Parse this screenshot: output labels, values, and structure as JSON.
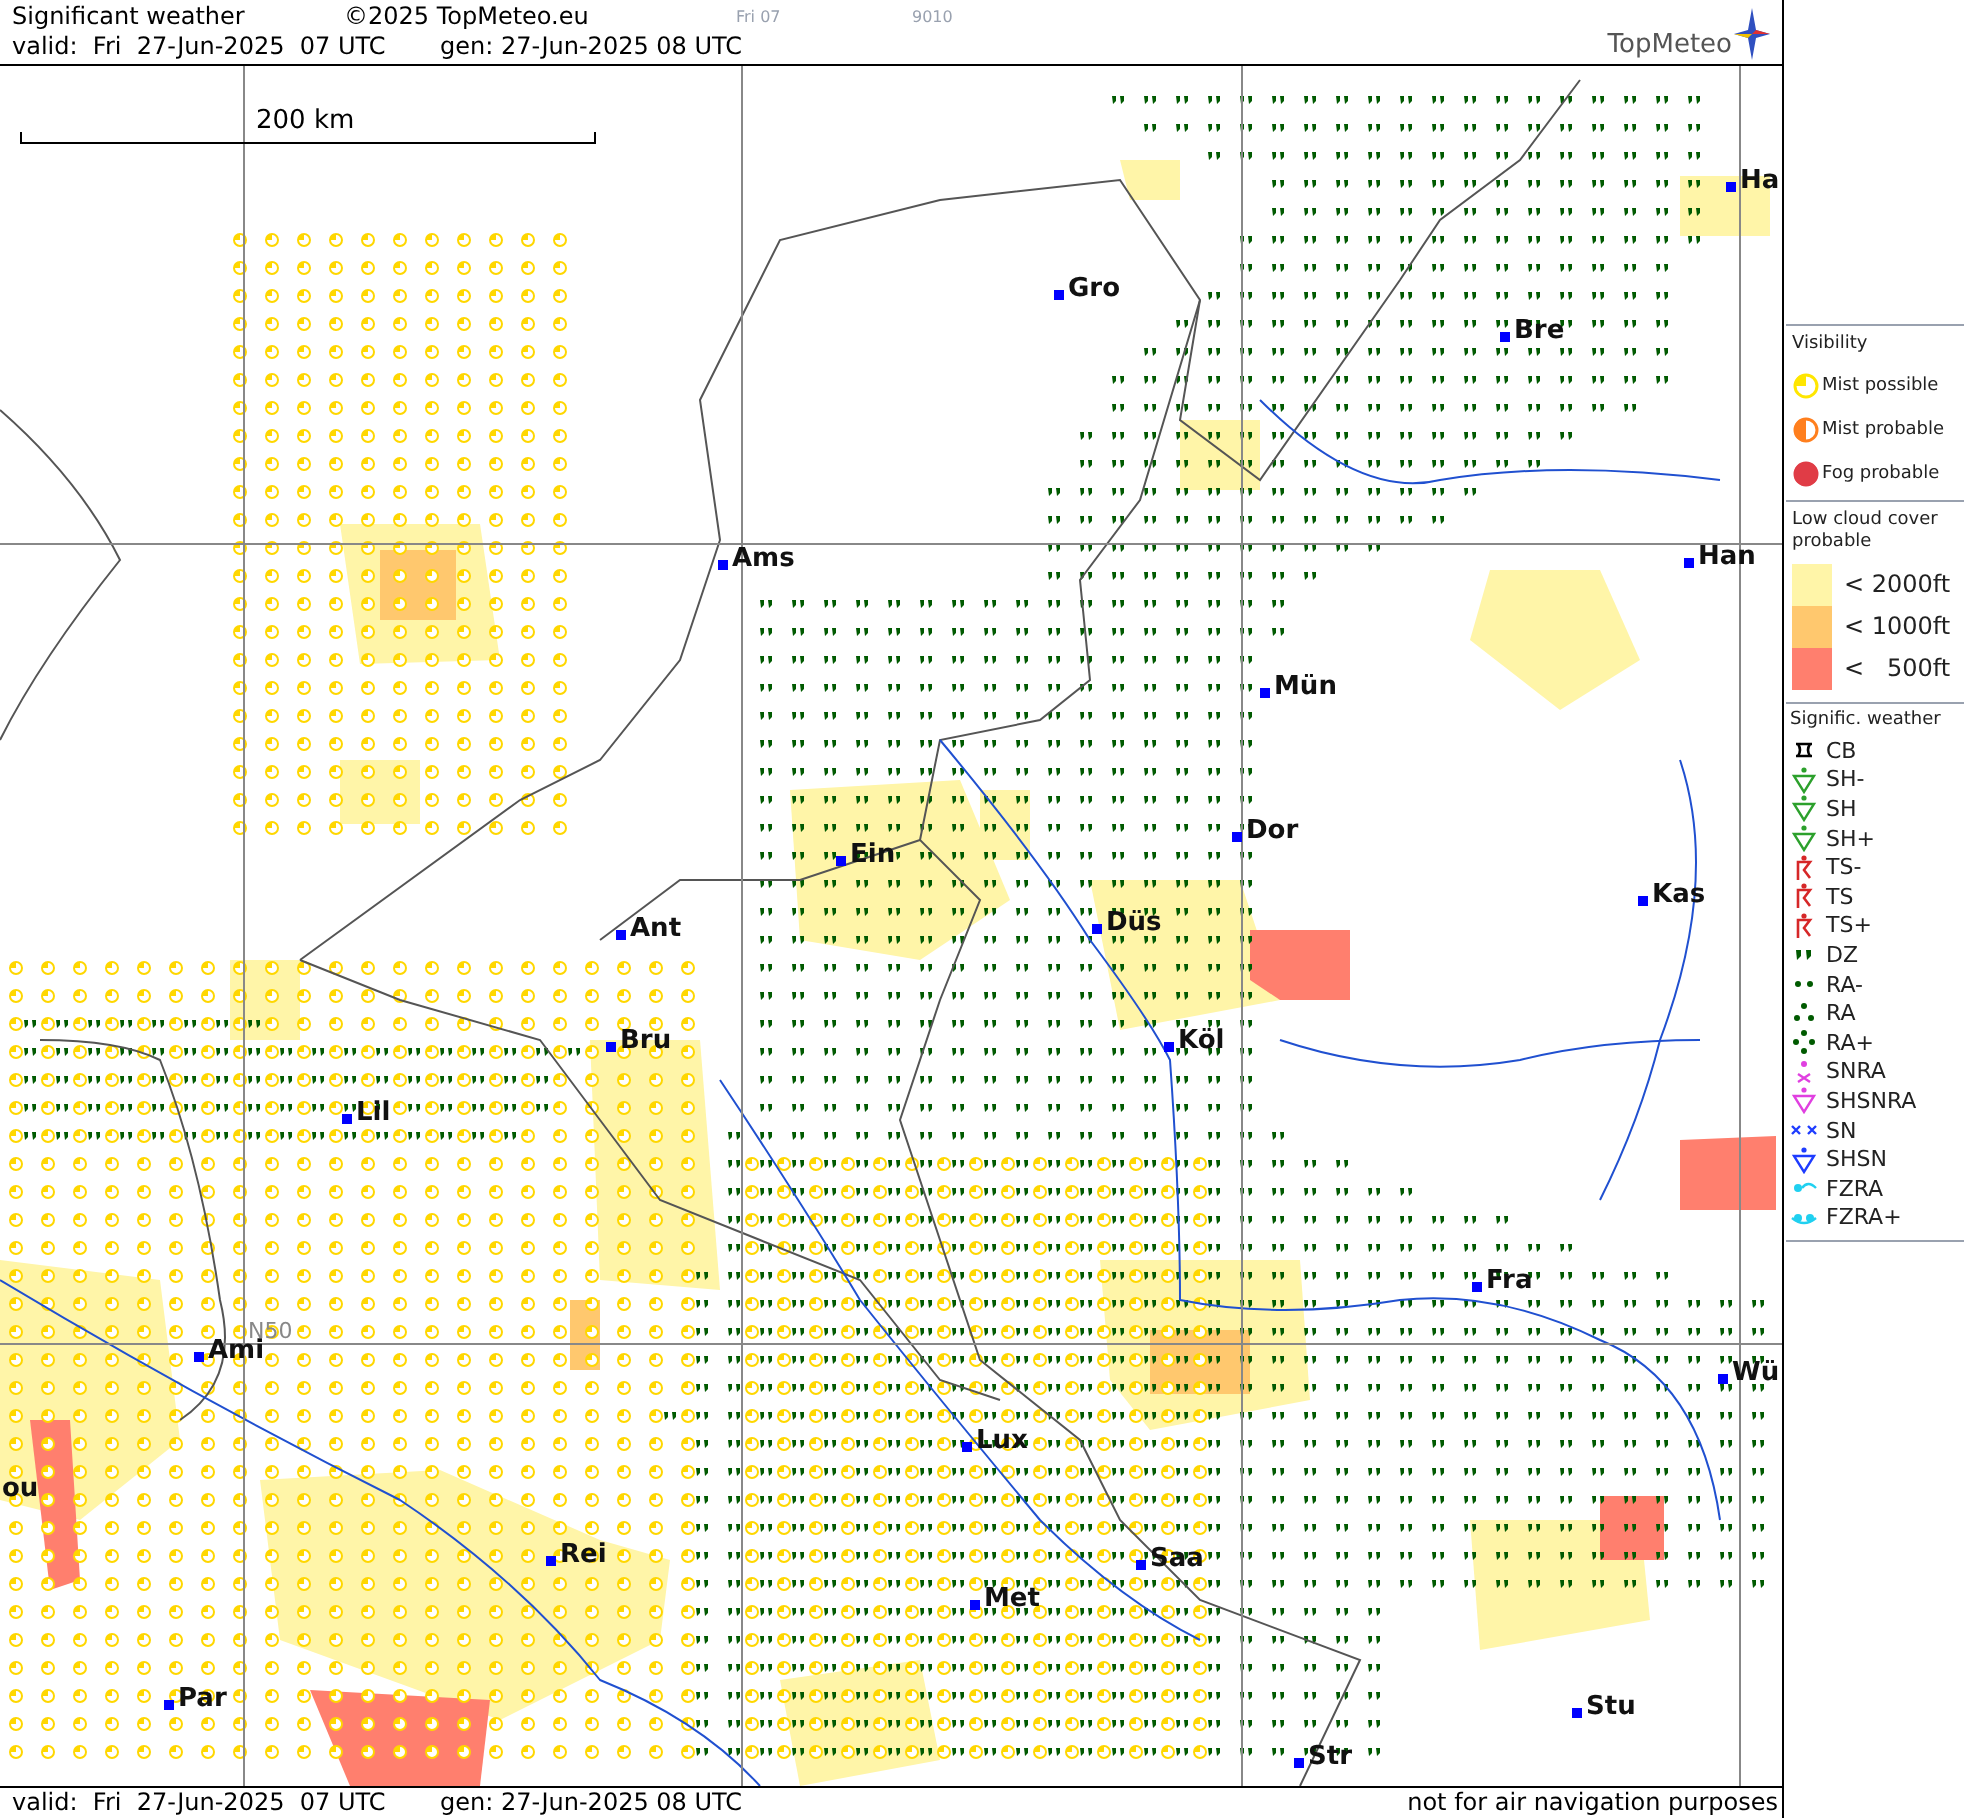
{
  "header": {
    "title": "Significant weather",
    "copyright": "©2025 TopMeteo.eu",
    "faint_day": "Fri 07",
    "faint_code": "9010",
    "valid": "valid:  Fri  27-Jun-2025  07 UTC",
    "generated": "gen: 27-Jun-2025 08 UTC",
    "logo": "TopMeteo"
  },
  "map": {
    "scale": "200 km",
    "latitude_label": "N50",
    "cities": [
      {
        "name": "Gro"
      },
      {
        "name": "Bre"
      },
      {
        "name": "Ha"
      },
      {
        "name": "Ams"
      },
      {
        "name": "Han"
      },
      {
        "name": "Mün"
      },
      {
        "name": "Dor"
      },
      {
        "name": "Ein"
      },
      {
        "name": "Kas"
      },
      {
        "name": "Ant"
      },
      {
        "name": "Düs"
      },
      {
        "name": "Bru"
      },
      {
        "name": "Köl"
      },
      {
        "name": "Lil"
      },
      {
        "name": "Fra"
      },
      {
        "name": "Ami"
      },
      {
        "name": "Wü"
      },
      {
        "name": "Lux"
      },
      {
        "name": "ou"
      },
      {
        "name": "Rei"
      },
      {
        "name": "Saa"
      },
      {
        "name": "Met"
      },
      {
        "name": "Par"
      },
      {
        "name": "Stu"
      },
      {
        "name": "Str"
      }
    ]
  },
  "footer": {
    "valid": "valid:  Fri  27-Jun-2025  07 UTC",
    "generated": "gen: 27-Jun-2025 08 UTC",
    "note": "not for air navigation purposes"
  },
  "legend": {
    "visibility": {
      "title": "Visibility",
      "items": [
        {
          "label": "Mist possible",
          "kind": "quarter",
          "color": "#ffe600"
        },
        {
          "label": "Mist probable",
          "kind": "half",
          "color": "#ff7f1e"
        },
        {
          "label": "Fog probable",
          "kind": "full",
          "color": "#e03c46"
        }
      ]
    },
    "low_cloud": {
      "title": "Low cloud cover probable",
      "bands": [
        {
          "label": "< 2000ft",
          "color": "#fff5a8"
        },
        {
          "label": "< 1000ft",
          "color": "#ffc86e"
        },
        {
          "label": "<   500ft",
          "color": "#ff7f6e"
        }
      ]
    },
    "weather": {
      "title": "Signific. weather",
      "items": [
        {
          "label": "CB",
          "kind": "cb",
          "color": "#000000"
        },
        {
          "label": "SH-",
          "kind": "shower",
          "color": "#2ca02c"
        },
        {
          "label": "SH",
          "kind": "shower",
          "color": "#2ca02c"
        },
        {
          "label": "SH+",
          "kind": "shower",
          "color": "#2ca02c"
        },
        {
          "label": "TS-",
          "kind": "thunder",
          "color": "#d62728"
        },
        {
          "label": "TS",
          "kind": "thunder",
          "color": "#d62728"
        },
        {
          "label": "TS+",
          "kind": "thunder",
          "color": "#d62728"
        },
        {
          "label": "DZ",
          "kind": "drizzle",
          "color": "#005a00"
        },
        {
          "label": "RA-",
          "kind": "rain2",
          "color": "#005a00"
        },
        {
          "label": "RA",
          "kind": "rain3",
          "color": "#005a00"
        },
        {
          "label": "RA+",
          "kind": "rain4",
          "color": "#005a00"
        },
        {
          "label": "SNRA",
          "kind": "snowrain",
          "color": "#e040e0"
        },
        {
          "label": "SHSNRA",
          "kind": "shower",
          "color": "#e040e0"
        },
        {
          "label": "SN",
          "kind": "snow",
          "color": "#1e3cff"
        },
        {
          "label": "SHSN",
          "kind": "shower",
          "color": "#1e3cff"
        },
        {
          "label": "FZRA",
          "kind": "freezing",
          "color": "#20d0f0"
        },
        {
          "label": "FZRA+",
          "kind": "freezing2",
          "color": "#20d0f0"
        }
      ]
    }
  }
}
